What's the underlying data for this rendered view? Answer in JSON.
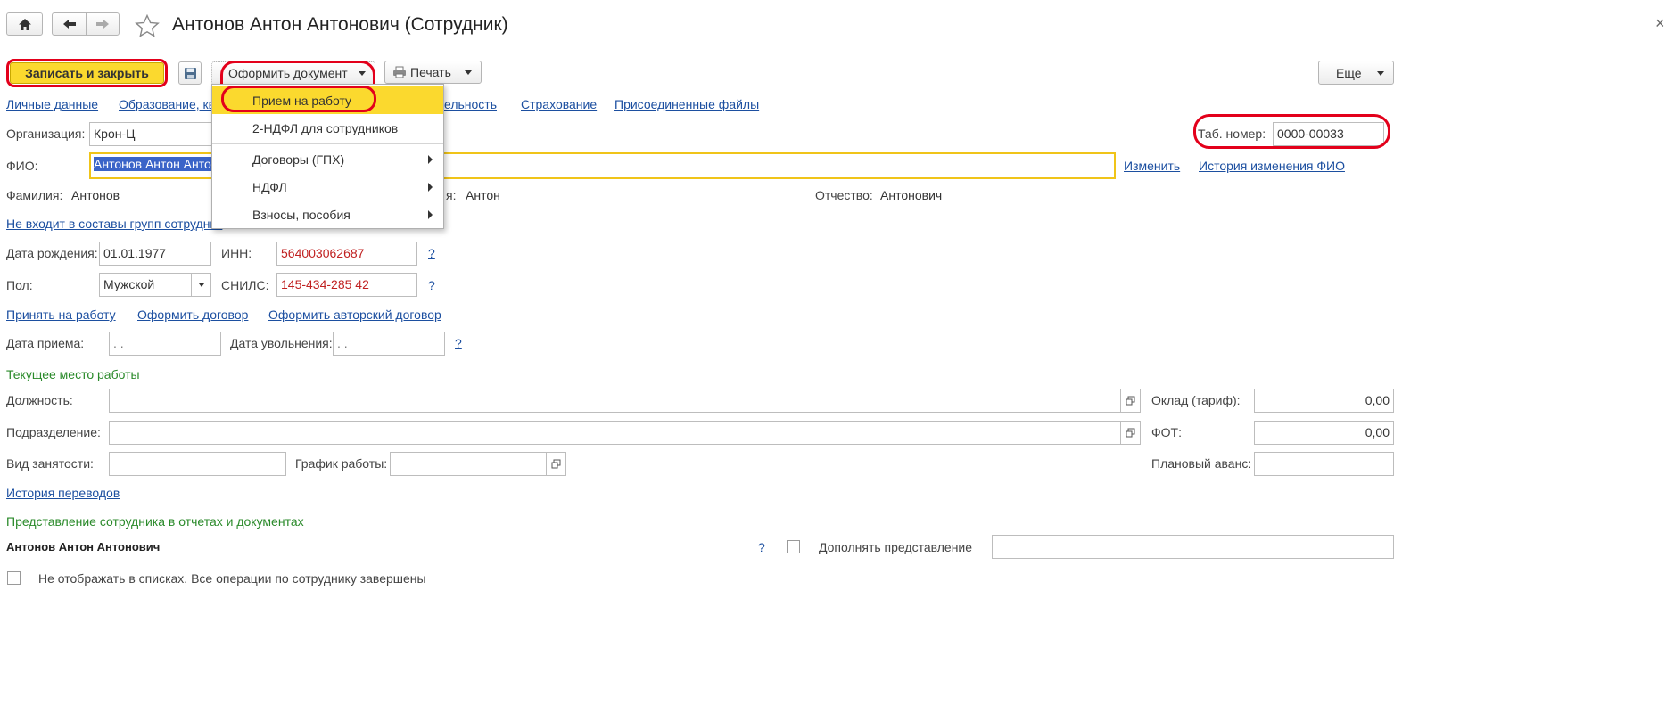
{
  "window": {
    "title": "Антонов Антон Антонович (Сотрудник)"
  },
  "toolbar": {
    "save_close_label": "Записать и закрыть",
    "document_label": "Оформить документ",
    "print_label": "Печать",
    "more_label": "Еще"
  },
  "document_menu": {
    "items": [
      {
        "label": "Прием на работу",
        "submenu": false,
        "selected": true
      },
      {
        "label": "2-НДФЛ для сотрудников",
        "submenu": false,
        "selected": false
      },
      {
        "label": "Договоры (ГПХ)",
        "submenu": true,
        "selected": false
      },
      {
        "label": "НДФЛ",
        "submenu": true,
        "selected": false
      },
      {
        "label": "Взносы, пособия",
        "submenu": true,
        "selected": false
      }
    ]
  },
  "nav_links": {
    "personal": "Личные данные",
    "education": "Образование, кв",
    "activity": "ельность",
    "insurance": "Страхование",
    "files": "Присоединенные файлы"
  },
  "form": {
    "org_label": "Организация:",
    "org_value": "Крон-Ц",
    "tab_label": "Таб. номер:",
    "tab_value": "0000-00033",
    "fio_label": "ФИО:",
    "fio_value": "Антонов Антон Антонович",
    "change_link": "Изменить",
    "fio_history_link": "История изменения ФИО",
    "surname_label": "Фамилия:",
    "surname_value": "Антонов",
    "name_label": "я:",
    "name_value": "Антон",
    "patronymic_label": "Отчество:",
    "patronymic_value": "Антонович",
    "groups_link": "Не входит в составы групп сотрудник",
    "birth_label": "Дата рождения:",
    "birth_value": "01.01.1977",
    "inn_label": "ИНН:",
    "inn_value": "564003062687",
    "help": "?",
    "sex_label": "Пол:",
    "sex_value": "Мужской",
    "snils_label": "СНИЛС:",
    "snils_value": "145-434-285 42",
    "hire_link": "Принять на работу",
    "contract_link": "Оформить договор",
    "author_contract_link": "Оформить авторский договор",
    "hire_date_label": "Дата приема:",
    "hire_date_value": " .  .",
    "fire_date_label": "Дата увольнения:",
    "fire_date_value": " .  .",
    "current_work_section": "Текущее место работы",
    "position_label": "Должность:",
    "salary_label": "Оклад (тариф):",
    "salary_value": "0,00",
    "department_label": "Подразделение:",
    "fot_label": "ФОТ:",
    "fot_value": "0,00",
    "employment_label": "Вид занятости:",
    "schedule_label": "График работы:",
    "advance_label": "Плановый аванс:",
    "transfers_link": "История переводов",
    "presentation_section": "Представление сотрудника в отчетах и документах",
    "presentation_value": "Антонов Антон Антонович",
    "supplement_label": "Дополнять представление",
    "hide_label": "Не отображать в списках. Все операции по сотруднику завершены"
  },
  "colors": {
    "accent_yellow": "#fbd92e",
    "highlight_red": "#e3001b",
    "link_blue": "#1c4fa0",
    "section_green": "#2a8a2a",
    "value_red": "#c02020"
  }
}
